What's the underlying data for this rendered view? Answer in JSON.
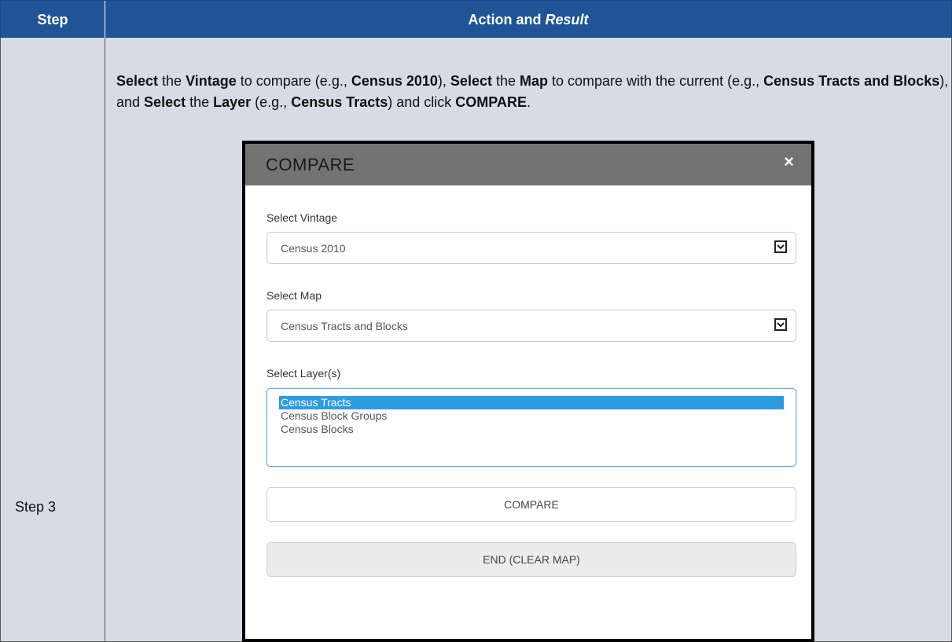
{
  "header": {
    "step_label": "Step",
    "action_label": "Action and",
    "action_italic": "Result"
  },
  "row": {
    "step_text": "Step 3",
    "instruction": {
      "p1": "Select",
      "p2": " the ",
      "p3": "Vintage",
      "p4": " to compare (e.g., ",
      "p5": "Census 2010",
      "p6": "), ",
      "p7": "Select",
      "p8": " the ",
      "p9": "Map",
      "p10": " to compare with the current (e.g., ",
      "p11": "Census Tracts and Blocks",
      "p12": "), and ",
      "p13": "Select",
      "p14": " the ",
      "p15": "Layer",
      "p16": " (e.g., ",
      "p17": "Census Tracts",
      "p18": ") and click ",
      "p19": "COMPARE",
      "p20": "."
    }
  },
  "dialog": {
    "title": "COMPARE",
    "close_symbol": "×",
    "vintage": {
      "label": "Select Vintage",
      "value": "Census 2010"
    },
    "map": {
      "label": "Select Map",
      "value": "Census Tracts and Blocks"
    },
    "layers": {
      "label": "Select Layer(s)",
      "options": [
        "Census Tracts",
        "Census Block Groups",
        "Census Blocks"
      ],
      "selected": "Census Tracts"
    },
    "compare_button": "COMPARE",
    "end_button": "END (CLEAR MAP)"
  },
  "colors": {
    "header_bg": "#1f5597",
    "row_bg": "#d6dce5",
    "dialog_header_bg": "#737373",
    "selected_option_bg": "#2d9be0"
  },
  "icons": {
    "close": "close-icon",
    "dropdown": "chevron-down-icon"
  }
}
